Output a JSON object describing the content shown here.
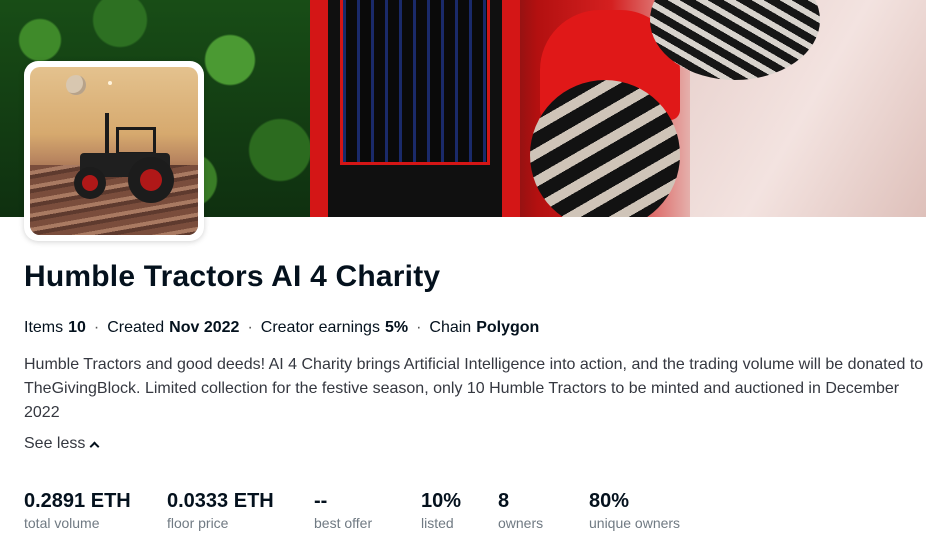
{
  "collection": {
    "title": "Humble Tractors AI 4 Charity",
    "meta": {
      "items_label": "Items",
      "items_value": "10",
      "created_label": "Created",
      "created_value": "Nov 2022",
      "earnings_label": "Creator earnings",
      "earnings_value": "5%",
      "chain_label": "Chain",
      "chain_value": "Polygon",
      "separator": "·"
    },
    "description": "Humble Tractors and good deeds! AI 4 Charity brings Artificial Intelligence into action, and the trading volume will be donated to TheGivingBlock. Limited collection for the festive season, only 10 Humble Tractors to be minted and auctioned in December 2022",
    "see_less_label": "See less",
    "see_less_icon": "chevron-up-icon"
  },
  "stats": [
    {
      "value": "0.2891 ETH",
      "label": "total volume"
    },
    {
      "value": "0.0333 ETH",
      "label": "floor price"
    },
    {
      "value": "--",
      "label": "best offer"
    },
    {
      "value": "10%",
      "label": "listed"
    },
    {
      "value": "8",
      "label": "owners"
    },
    {
      "value": "80%",
      "label": "unique owners"
    }
  ],
  "colors": {
    "text_primary": "#04111d",
    "text_secondary": "#707a83",
    "tractor_red": "#d41616"
  }
}
